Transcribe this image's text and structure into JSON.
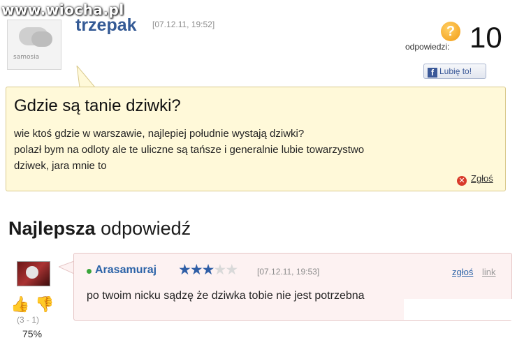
{
  "watermark": "www.wiocha.pl",
  "avatar_site": "samosia",
  "question": {
    "author": "trzepak",
    "date": "[07.12.11, 19:52]",
    "answers_label": "odpowiedzi:",
    "answers_count": "10",
    "like_label": "Lubię to!",
    "title": "Gdzie są tanie dziwki?",
    "body_lines": [
      "wie ktoś gdzie w warszawie, najlepiej południe wystają dziwki?",
      "polazł bym na odloty ale te uliczne są tańsze i generalnie lubie towarzystwo",
      "dziwek, jara mnie to"
    ],
    "report_label": "Zgłoś"
  },
  "best_answer": {
    "heading_bold": "Najlepsza",
    "heading_rest": "odpowiedź",
    "author": "Arasamuraj",
    "rating_stars": 3,
    "max_stars": 5,
    "date": "[07.12.11, 19:53]",
    "report_label": "zgłoś",
    "link_label": "link",
    "text": "po twoim nicku sądzę że dziwka tobie nie jest potrzebna",
    "votes": "(3 - 1)",
    "percent": "75%"
  },
  "icons": {
    "question": "question-mark-icon",
    "facebook": "facebook-icon",
    "report": "report-icon",
    "thumbs_up": "thumbs-up-icon",
    "thumbs_down": "thumbs-down-icon"
  }
}
